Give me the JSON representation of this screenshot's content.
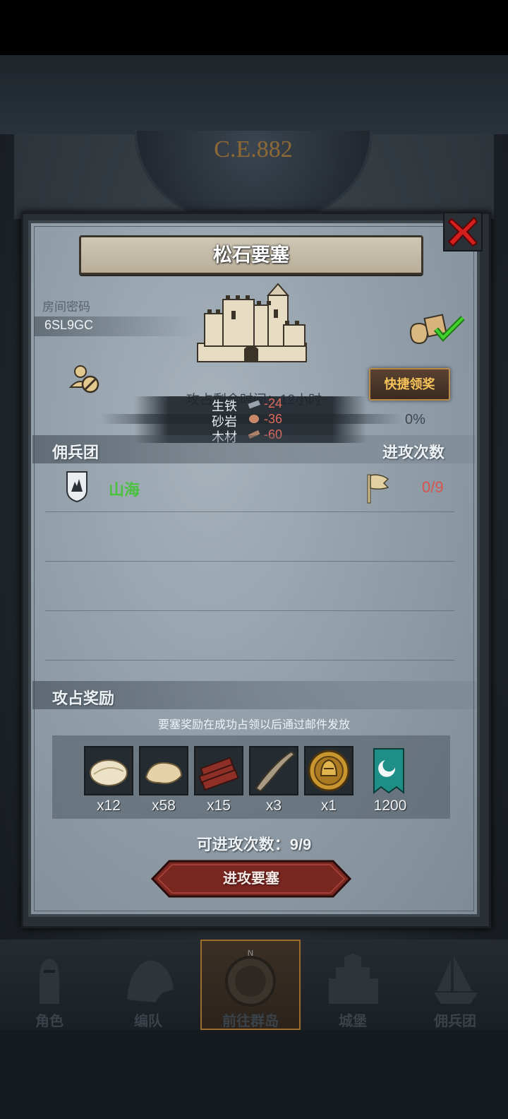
{
  "header": {
    "era_label": "C.E.882"
  },
  "dialog": {
    "title": "松石要塞",
    "room_label": "房间密码",
    "room_code": "6SL9GC",
    "claim_button": "快捷领奖",
    "remaining_time": "攻占剩余时间：12小时",
    "progress_percent": "0%",
    "progress_value": 0,
    "costs": [
      {
        "name": "生铁",
        "value": "-24",
        "icon": "iron-icon"
      },
      {
        "name": "砂岩",
        "value": "-36",
        "icon": "sandstone-icon"
      },
      {
        "name": "木材",
        "value": "-60",
        "icon": "wood-icon"
      }
    ],
    "mercenary_header": "佣兵团",
    "attack_count_header": "进攻次数",
    "mercenary": {
      "name": "山海",
      "attack_count": "0/9"
    },
    "reward_header": "攻占奖励",
    "reward_note": "要塞奖励在成功占领以后通过邮件发放",
    "rewards": [
      {
        "icon": "cotton-icon",
        "qty": "x12"
      },
      {
        "icon": "fur-icon",
        "qty": "x58"
      },
      {
        "icon": "timber-icon",
        "qty": "x15"
      },
      {
        "icon": "horn-icon",
        "qty": "x3"
      },
      {
        "icon": "helmet-coin-icon",
        "qty": "x1"
      },
      {
        "icon": "guild-banner-icon",
        "qty": "1200"
      }
    ],
    "can_attack": "可进攻次数：9/9",
    "attack_button": "进攻要塞"
  },
  "nav": [
    {
      "label": "角色",
      "icon": "knight-icon"
    },
    {
      "label": "编队",
      "icon": "helmet-icon"
    },
    {
      "label": "前往群岛",
      "icon": "compass-icon",
      "active": true
    },
    {
      "label": "城堡",
      "icon": "castle-icon"
    },
    {
      "label": "佣兵团",
      "icon": "ship-icon"
    }
  ],
  "colors": {
    "accent_gold": "#f6c25a",
    "merc_green": "#4ac23f",
    "count_red": "#d9534f",
    "cost_red": "#e06a5f"
  }
}
